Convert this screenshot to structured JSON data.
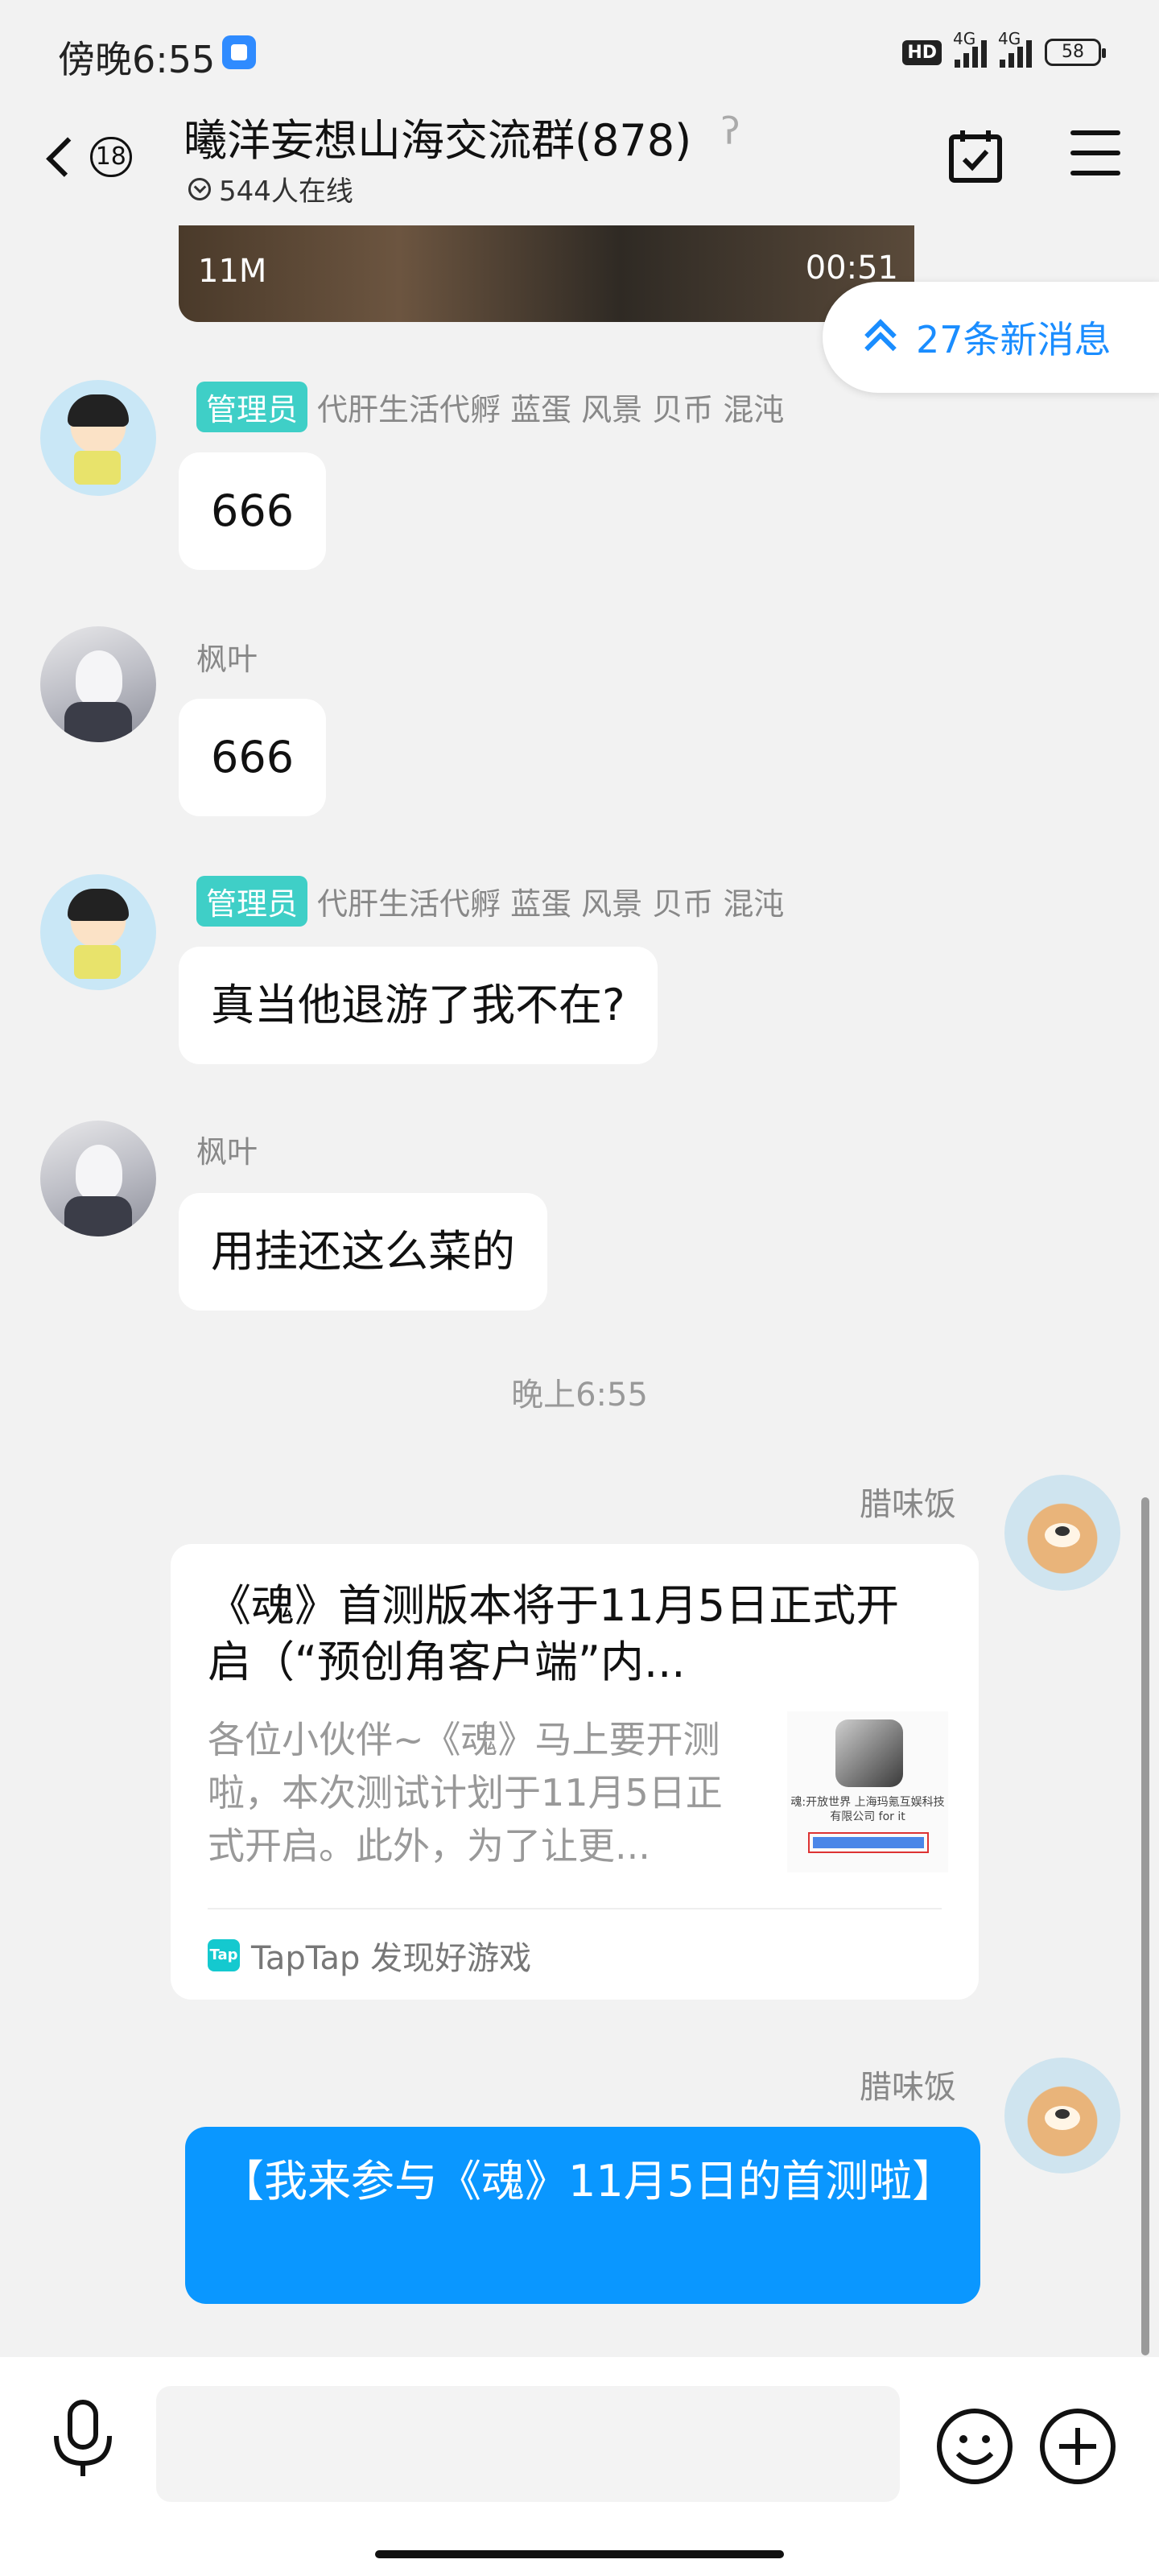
{
  "status_bar": {
    "time": "傍晚6:55",
    "hd": "HD",
    "signal1": "4G",
    "signal2": "4G",
    "battery": "58"
  },
  "header": {
    "back_badge": "18",
    "title": "曦洋妄想山海交流群(878)",
    "ear_icon": "ear-icon",
    "online": "544人在线"
  },
  "video": {
    "size": "11M",
    "duration": "00:51"
  },
  "new_messages": "27条新消息",
  "messages": [
    {
      "admin_tag": "管理员",
      "sender": "代肝生活代孵 蓝蛋 风景 贝币 混沌",
      "text": "666"
    },
    {
      "sender": "枫叶",
      "text": "666"
    },
    {
      "admin_tag": "管理员",
      "sender": "代肝生活代孵 蓝蛋 风景 贝币 混沌",
      "text": "真当他退游了我不在?"
    },
    {
      "sender": "枫叶",
      "text": "用挂还这么菜的"
    }
  ],
  "time_separator": "晚上6:55",
  "right_messages": [
    {
      "sender": "腊味饭"
    },
    {
      "sender": "腊味饭",
      "text": "【我来参与《魂》11月5日的首测啦】"
    }
  ],
  "link_card": {
    "title": "《魂》首测版本将于11月5日正式开启（“预创角客户端”内...",
    "description": "各位小伙伴~《魂》马上要开测啦，本次测试计划于11月5日正式开启。此外，为了让更...",
    "thumb_text": "魂:开放世界 上海玛氪互娱科技有限公司 for it",
    "source_logo": "Tap",
    "source": "TapTap 发现好游戏"
  },
  "input": {
    "placeholder": ""
  },
  "colors": {
    "accent": "#0a97ff",
    "admin_tag": "#3fcfc7",
    "background": "#f2f2f2"
  }
}
